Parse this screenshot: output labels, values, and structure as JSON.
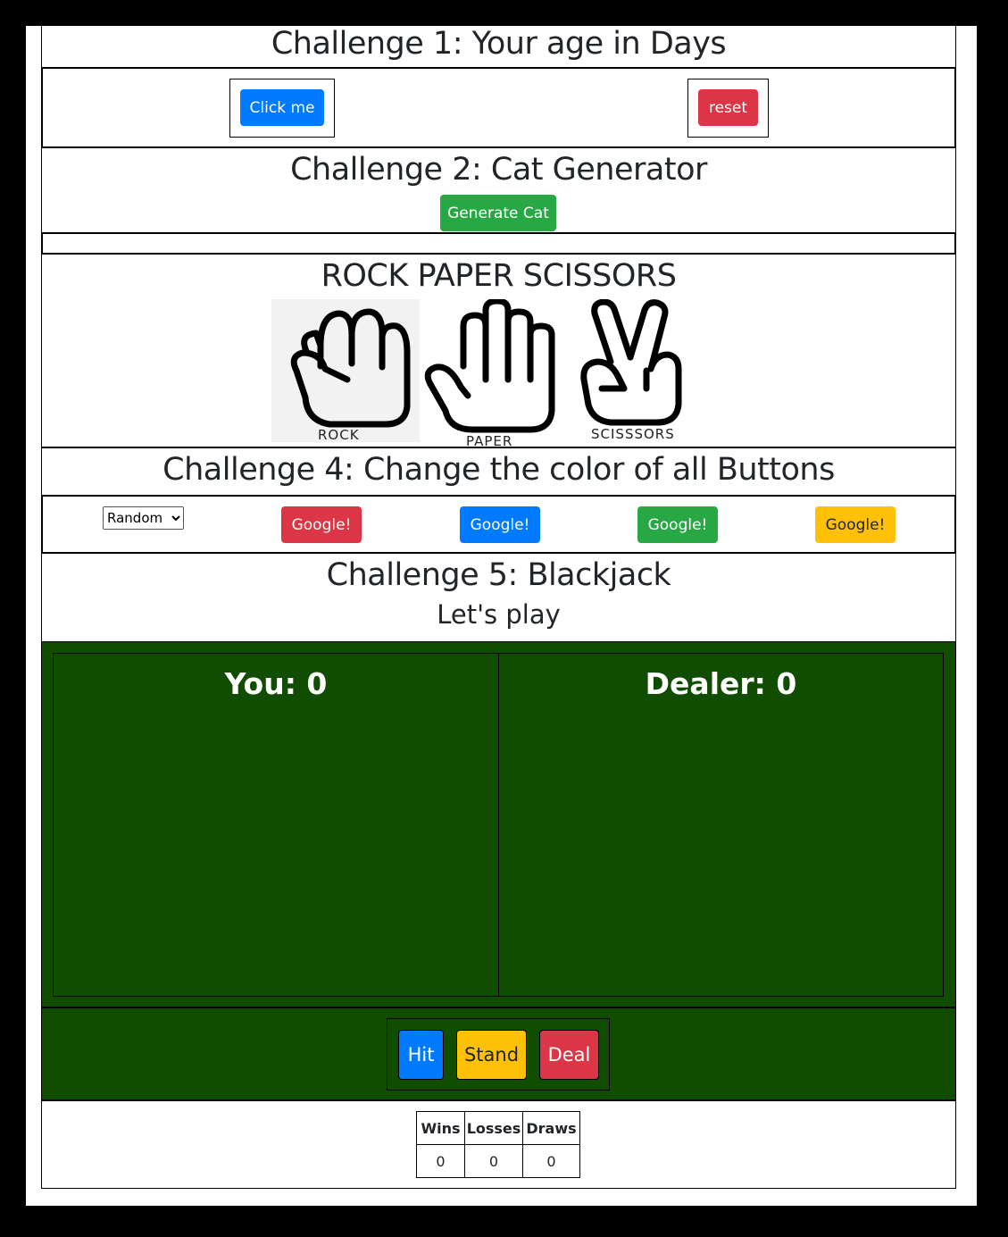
{
  "challenge1": {
    "title": "Challenge 1: Your age in Days",
    "click_label": "Click me",
    "reset_label": "reset"
  },
  "challenge2": {
    "title": "Challenge 2: Cat Generator",
    "generate_label": "Generate Cat"
  },
  "challenge3": {
    "title": "ROCK PAPER SCISSORS",
    "choices": [
      {
        "label": "ROCK",
        "icon": "rock-hand-icon"
      },
      {
        "label": "PAPER",
        "icon": "paper-hand-icon"
      },
      {
        "label": "SCISSSORS",
        "icon": "scissors-hand-icon"
      }
    ]
  },
  "challenge4": {
    "title": "Challenge 4: Change the color of all Buttons",
    "select_value": "Random",
    "buttons": [
      "Google!",
      "Google!",
      "Google!",
      "Google!"
    ],
    "button_colors": [
      "#dc3545",
      "#007bff",
      "#28a745",
      "#ffc107"
    ]
  },
  "challenge5": {
    "title": "Challenge 5: Blackjack",
    "subtitle": "Let's play",
    "you_label": "You: ",
    "you_score": "0",
    "dealer_label": "Dealer: ",
    "dealer_score": "0",
    "hit_label": "Hit",
    "stand_label": "Stand",
    "deal_label": "Deal",
    "table_color": "#114d00",
    "score_headers": [
      "Wins",
      "Losses",
      "Draws"
    ],
    "score_values": [
      "0",
      "0",
      "0"
    ]
  }
}
